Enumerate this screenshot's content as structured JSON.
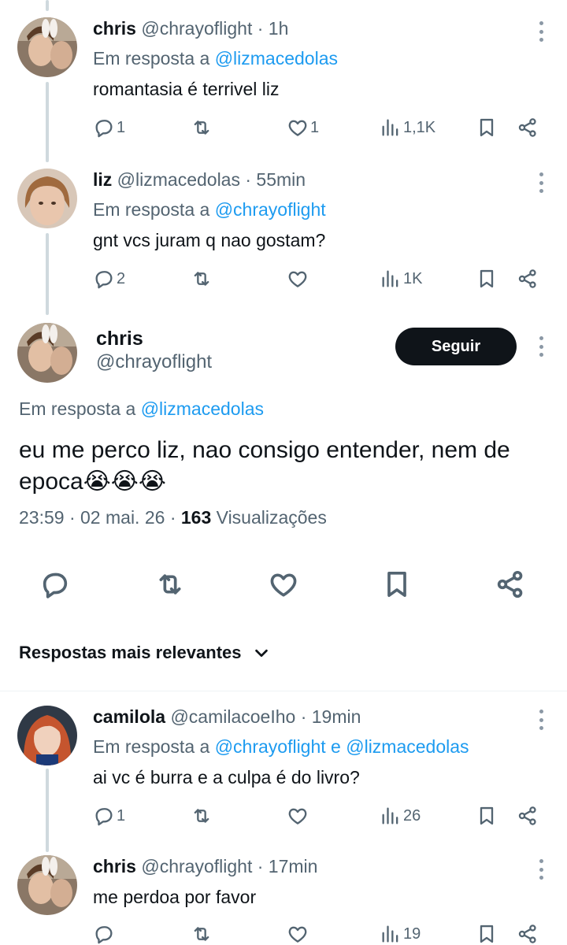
{
  "tweets": [
    {
      "name": "chris",
      "handle": "@chrayoflight",
      "time": "1h",
      "reply_prefix": "Em resposta a",
      "reply_mentions": [
        "@lizmacedolas"
      ],
      "reply_joiner": "",
      "text": "romantasia é terrivel liz",
      "replies": "1",
      "retweets": "",
      "likes": "1",
      "views": "1,1K"
    },
    {
      "name": "liz",
      "handle": "@lizmacedolas",
      "time": "55min",
      "reply_prefix": "Em resposta a",
      "reply_mentions": [
        "@chrayoflight"
      ],
      "reply_joiner": "",
      "text": "gnt vcs juram q nao gostam?",
      "replies": "2",
      "retweets": "",
      "likes": "",
      "views": "1K"
    }
  ],
  "main_tweet": {
    "name": "chris",
    "handle": "@chrayoflight",
    "follow_label": "Seguir",
    "reply_prefix": "Em resposta a",
    "reply_mention": "@lizmacedolas",
    "text": "eu me perco liz, nao consigo entender, nem de epoca😭😭😭",
    "time": "23:59",
    "date": "02 mai. 26",
    "views_count": "163",
    "views_label": "Visualizações"
  },
  "sort_label": "Respostas mais relevantes",
  "replies": [
    {
      "name": "camilola",
      "handle": "@camilacoeIho",
      "time": "19min",
      "reply_prefix": "Em resposta a",
      "reply_mentions": [
        "@chrayoflight",
        "@lizmacedolas"
      ],
      "reply_joiner": "e",
      "text": "ai vc é burra e a culpa é do livro?",
      "replies": "1",
      "retweets": "",
      "likes": "",
      "views": "26"
    },
    {
      "name": "chris",
      "handle": "@chrayoflight",
      "time": "17min",
      "text": "me perdoa por favor",
      "replies": "",
      "retweets": "",
      "likes": "",
      "views": "19"
    }
  ],
  "colors": {
    "text": "#0f1419",
    "secondary": "#536471",
    "link": "#1d9bf0",
    "follow_bg": "#0f1419",
    "thread_line": "#cfd9de"
  },
  "icons": [
    "reply-icon",
    "retweet-icon",
    "like-icon",
    "views-icon",
    "bookmark-icon",
    "share-icon",
    "more-icon",
    "chevron-down-icon"
  ]
}
